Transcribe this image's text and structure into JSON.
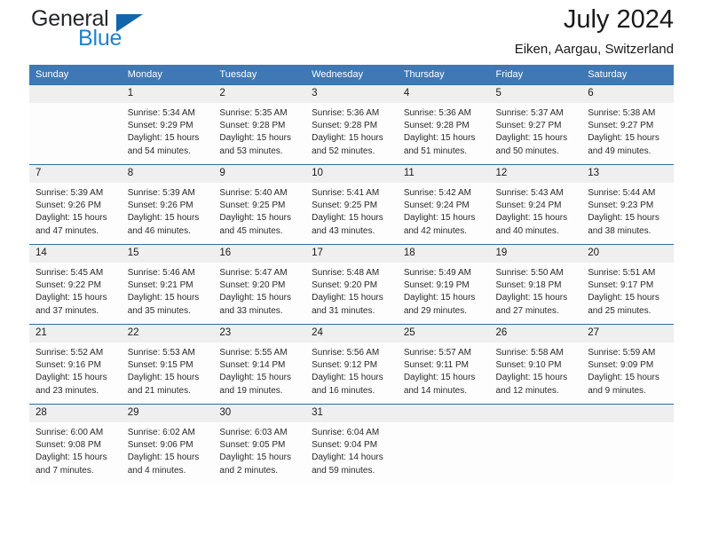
{
  "brand": {
    "word_one": "General",
    "word_two": "Blue",
    "triangle_icon": "brand-triangle-icon"
  },
  "header": {
    "title": "July 2024",
    "subtitle": "Eiken, Aargau, Switzerland"
  },
  "calendar": {
    "weekday_headers": [
      "Sunday",
      "Monday",
      "Tuesday",
      "Wednesday",
      "Thursday",
      "Friday",
      "Saturday"
    ],
    "accent_color": "#3f78b5",
    "row_border_color": "#2f6eae",
    "daynum_band_color": "#efefef",
    "weeks": [
      [
        {
          "day": "",
          "lines": []
        },
        {
          "day": "1",
          "lines": [
            "Sunrise: 5:34 AM",
            "Sunset: 9:29 PM",
            "Daylight: 15 hours",
            "and 54 minutes."
          ]
        },
        {
          "day": "2",
          "lines": [
            "Sunrise: 5:35 AM",
            "Sunset: 9:28 PM",
            "Daylight: 15 hours",
            "and 53 minutes."
          ]
        },
        {
          "day": "3",
          "lines": [
            "Sunrise: 5:36 AM",
            "Sunset: 9:28 PM",
            "Daylight: 15 hours",
            "and 52 minutes."
          ]
        },
        {
          "day": "4",
          "lines": [
            "Sunrise: 5:36 AM",
            "Sunset: 9:28 PM",
            "Daylight: 15 hours",
            "and 51 minutes."
          ]
        },
        {
          "day": "5",
          "lines": [
            "Sunrise: 5:37 AM",
            "Sunset: 9:27 PM",
            "Daylight: 15 hours",
            "and 50 minutes."
          ]
        },
        {
          "day": "6",
          "lines": [
            "Sunrise: 5:38 AM",
            "Sunset: 9:27 PM",
            "Daylight: 15 hours",
            "and 49 minutes."
          ]
        }
      ],
      [
        {
          "day": "7",
          "lines": [
            "Sunrise: 5:39 AM",
            "Sunset: 9:26 PM",
            "Daylight: 15 hours",
            "and 47 minutes."
          ]
        },
        {
          "day": "8",
          "lines": [
            "Sunrise: 5:39 AM",
            "Sunset: 9:26 PM",
            "Daylight: 15 hours",
            "and 46 minutes."
          ]
        },
        {
          "day": "9",
          "lines": [
            "Sunrise: 5:40 AM",
            "Sunset: 9:25 PM",
            "Daylight: 15 hours",
            "and 45 minutes."
          ]
        },
        {
          "day": "10",
          "lines": [
            "Sunrise: 5:41 AM",
            "Sunset: 9:25 PM",
            "Daylight: 15 hours",
            "and 43 minutes."
          ]
        },
        {
          "day": "11",
          "lines": [
            "Sunrise: 5:42 AM",
            "Sunset: 9:24 PM",
            "Daylight: 15 hours",
            "and 42 minutes."
          ]
        },
        {
          "day": "12",
          "lines": [
            "Sunrise: 5:43 AM",
            "Sunset: 9:24 PM",
            "Daylight: 15 hours",
            "and 40 minutes."
          ]
        },
        {
          "day": "13",
          "lines": [
            "Sunrise: 5:44 AM",
            "Sunset: 9:23 PM",
            "Daylight: 15 hours",
            "and 38 minutes."
          ]
        }
      ],
      [
        {
          "day": "14",
          "lines": [
            "Sunrise: 5:45 AM",
            "Sunset: 9:22 PM",
            "Daylight: 15 hours",
            "and 37 minutes."
          ]
        },
        {
          "day": "15",
          "lines": [
            "Sunrise: 5:46 AM",
            "Sunset: 9:21 PM",
            "Daylight: 15 hours",
            "and 35 minutes."
          ]
        },
        {
          "day": "16",
          "lines": [
            "Sunrise: 5:47 AM",
            "Sunset: 9:20 PM",
            "Daylight: 15 hours",
            "and 33 minutes."
          ]
        },
        {
          "day": "17",
          "lines": [
            "Sunrise: 5:48 AM",
            "Sunset: 9:20 PM",
            "Daylight: 15 hours",
            "and 31 minutes."
          ]
        },
        {
          "day": "18",
          "lines": [
            "Sunrise: 5:49 AM",
            "Sunset: 9:19 PM",
            "Daylight: 15 hours",
            "and 29 minutes."
          ]
        },
        {
          "day": "19",
          "lines": [
            "Sunrise: 5:50 AM",
            "Sunset: 9:18 PM",
            "Daylight: 15 hours",
            "and 27 minutes."
          ]
        },
        {
          "day": "20",
          "lines": [
            "Sunrise: 5:51 AM",
            "Sunset: 9:17 PM",
            "Daylight: 15 hours",
            "and 25 minutes."
          ]
        }
      ],
      [
        {
          "day": "21",
          "lines": [
            "Sunrise: 5:52 AM",
            "Sunset: 9:16 PM",
            "Daylight: 15 hours",
            "and 23 minutes."
          ]
        },
        {
          "day": "22",
          "lines": [
            "Sunrise: 5:53 AM",
            "Sunset: 9:15 PM",
            "Daylight: 15 hours",
            "and 21 minutes."
          ]
        },
        {
          "day": "23",
          "lines": [
            "Sunrise: 5:55 AM",
            "Sunset: 9:14 PM",
            "Daylight: 15 hours",
            "and 19 minutes."
          ]
        },
        {
          "day": "24",
          "lines": [
            "Sunrise: 5:56 AM",
            "Sunset: 9:12 PM",
            "Daylight: 15 hours",
            "and 16 minutes."
          ]
        },
        {
          "day": "25",
          "lines": [
            "Sunrise: 5:57 AM",
            "Sunset: 9:11 PM",
            "Daylight: 15 hours",
            "and 14 minutes."
          ]
        },
        {
          "day": "26",
          "lines": [
            "Sunrise: 5:58 AM",
            "Sunset: 9:10 PM",
            "Daylight: 15 hours",
            "and 12 minutes."
          ]
        },
        {
          "day": "27",
          "lines": [
            "Sunrise: 5:59 AM",
            "Sunset: 9:09 PM",
            "Daylight: 15 hours",
            "and 9 minutes."
          ]
        }
      ],
      [
        {
          "day": "28",
          "lines": [
            "Sunrise: 6:00 AM",
            "Sunset: 9:08 PM",
            "Daylight: 15 hours",
            "and 7 minutes."
          ]
        },
        {
          "day": "29",
          "lines": [
            "Sunrise: 6:02 AM",
            "Sunset: 9:06 PM",
            "Daylight: 15 hours",
            "and 4 minutes."
          ]
        },
        {
          "day": "30",
          "lines": [
            "Sunrise: 6:03 AM",
            "Sunset: 9:05 PM",
            "Daylight: 15 hours",
            "and 2 minutes."
          ]
        },
        {
          "day": "31",
          "lines": [
            "Sunrise: 6:04 AM",
            "Sunset: 9:04 PM",
            "Daylight: 14 hours",
            "and 59 minutes."
          ]
        },
        {
          "day": "",
          "lines": []
        },
        {
          "day": "",
          "lines": []
        },
        {
          "day": "",
          "lines": []
        }
      ]
    ]
  }
}
